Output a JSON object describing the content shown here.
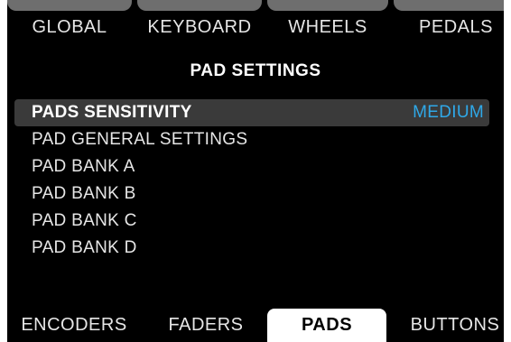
{
  "top_tabs": [
    "GLOBAL",
    "KEYBOARD",
    "WHEELS",
    "PEDALS"
  ],
  "title": "PAD SETTINGS",
  "menu": {
    "selected": {
      "label": "PADS SENSITIVITY",
      "value": "MEDIUM"
    },
    "items": [
      "PAD GENERAL SETTINGS",
      "PAD BANK A",
      "PAD BANK B",
      "PAD BANK C",
      "PAD BANK D"
    ]
  },
  "bottom_tabs": [
    "ENCODERS",
    "FADERS",
    "PADS",
    "BUTTONS"
  ],
  "active_bottom_tab": "PADS",
  "colors": {
    "background": "#000000",
    "selected_row": "#3a3a3a",
    "value_accent": "#2fa8e8",
    "tab_stub": "#6e6e6e"
  }
}
